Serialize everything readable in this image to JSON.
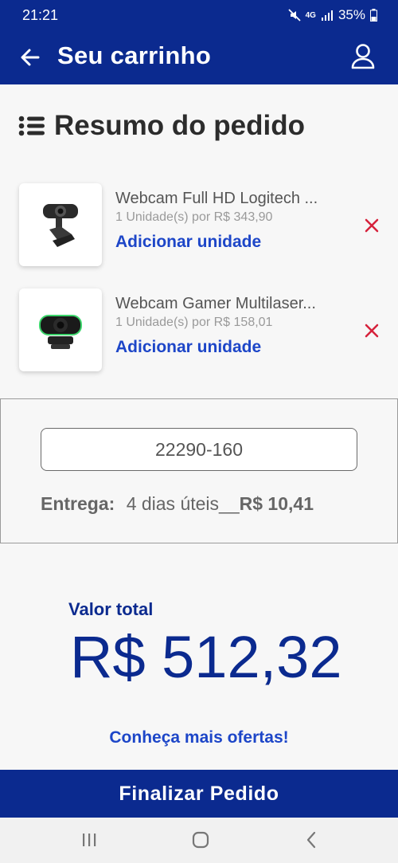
{
  "status_bar": {
    "time": "21:21",
    "network": "4G",
    "battery": "35%"
  },
  "header": {
    "title": "Seu carrinho"
  },
  "summary": {
    "title": "Resumo do pedido"
  },
  "items": [
    {
      "name": "Webcam Full HD Logitech ...",
      "subtitle": "1 Unidade(s) por R$ 343,90",
      "add_label": "Adicionar unidade"
    },
    {
      "name": "Webcam Gamer Multilaser...",
      "subtitle": "1 Unidade(s) por R$ 158,01",
      "add_label": "Adicionar unidade"
    }
  ],
  "shipping": {
    "cep_value": "22290-160",
    "delivery_label": "Entrega:",
    "delivery_time": "4 dias úteis",
    "delivery_separator": "__",
    "delivery_price": "R$ 10,41"
  },
  "total": {
    "label": "Valor total",
    "value": "R$ 512,32"
  },
  "offers_link": "Conheça mais ofertas!",
  "finish_button": "Finalizar Pedido",
  "colors": {
    "primary": "#0b2a8f",
    "link": "#1d46c8",
    "remove": "#d6213b"
  }
}
